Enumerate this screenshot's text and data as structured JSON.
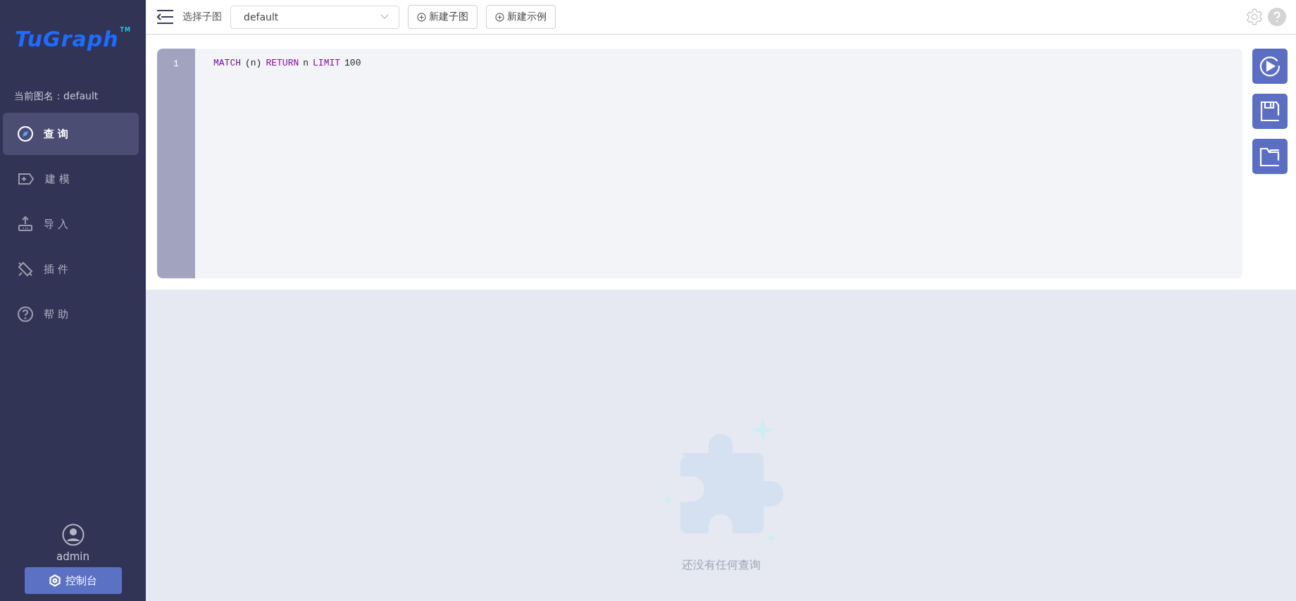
{
  "sidebar": {
    "logo": "TuGraph",
    "logo_mark": "TM",
    "current_graph": "当前图名：default",
    "items": [
      {
        "label": "查 询",
        "kind": "query",
        "selected": true
      },
      {
        "label": "建 模",
        "kind": "model",
        "selected": false
      },
      {
        "label": "导 入",
        "kind": "import",
        "selected": false
      },
      {
        "label": "插 件",
        "kind": "plugin",
        "selected": false
      },
      {
        "label": "帮 助",
        "kind": "help",
        "selected": false
      }
    ],
    "user": "admin",
    "console_button": "控制台"
  },
  "toolbar": {
    "select_label": "选择子图",
    "graph_select": "default",
    "buttons": [
      "新建子图",
      "新建示例"
    ]
  },
  "editor": {
    "lines": [
      {
        "number": "1",
        "tokens": [
          {
            "text": "MATCH",
            "kind": "keyword"
          },
          {
            "text": "(n)",
            "kind": "plain"
          },
          {
            "text": "RETURN",
            "kind": "keyword"
          },
          {
            "text": "n",
            "kind": "plain"
          },
          {
            "text": "LIMIT",
            "kind": "keyword"
          },
          {
            "text": "100",
            "kind": "number"
          }
        ]
      }
    ]
  },
  "actions": [
    {
      "kind": "run"
    },
    {
      "kind": "save"
    },
    {
      "kind": "open"
    }
  ],
  "results": {
    "empty_text": "还没有任何查询"
  }
}
